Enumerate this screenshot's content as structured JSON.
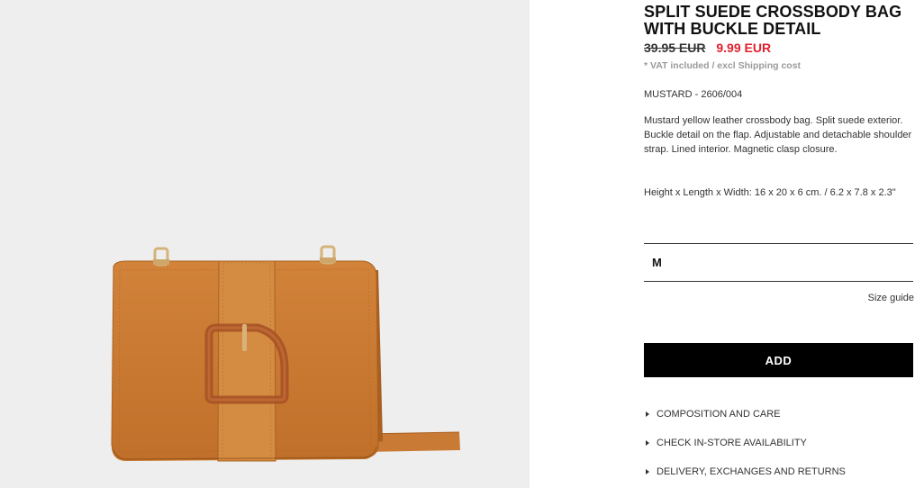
{
  "product": {
    "title": "SPLIT SUEDE CROSSBODY BAG WITH BUCKLE DETAIL",
    "old_price": "39.95 EUR",
    "sale_price": "9.99 EUR",
    "vat_note": "* VAT included / excl Shipping cost",
    "color_ref": "MUSTARD - 2606/004",
    "description": "Mustard yellow leather crossbody bag. Split suede exterior. Buckle detail on the flap. Adjustable and detachable shoulder strap. Lined interior. Magnetic clasp closure.",
    "dimensions": "Height x Length x Width: 16 x 20 x 6 cm. / 6.2 x 7.8 x 2.3\""
  },
  "size_selector": {
    "value": "M"
  },
  "size_guide_label": "Size guide",
  "add_button_label": "ADD",
  "accordion": [
    {
      "label": "COMPOSITION AND CARE"
    },
    {
      "label": "CHECK IN-STORE AVAILABILITY"
    },
    {
      "label": "DELIVERY, EXCHANGES AND RETURNS"
    }
  ],
  "colors": {
    "sale_price": "#e3202c",
    "image_background": "#eeeeee",
    "bag_suede": "#c8762e",
    "button_background": "#000000"
  },
  "icons": {
    "accordion_marker": "triangle-right-icon"
  }
}
